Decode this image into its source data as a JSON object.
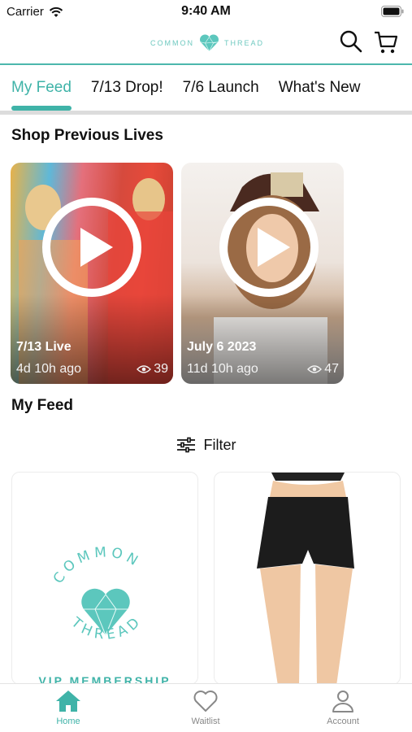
{
  "status_bar": {
    "carrier": "Carrier",
    "time": "9:40 AM"
  },
  "header": {
    "logo_left": "COMMON",
    "logo_right": "THREAD",
    "brand_color": "#3fb3a8"
  },
  "tabs": [
    {
      "label": "My Feed",
      "active": true
    },
    {
      "label": "7/13 Drop!",
      "active": false
    },
    {
      "label": "7/6 Launch",
      "active": false
    },
    {
      "label": "What's New",
      "active": false
    }
  ],
  "previous_lives": {
    "title": "Shop Previous Lives",
    "items": [
      {
        "title": "7/13 Live",
        "ago": "4d 10h ago",
        "views": "39"
      },
      {
        "title": "July 6 2023",
        "ago": "11d 10h ago",
        "views": "47"
      }
    ]
  },
  "feed": {
    "title": "My Feed",
    "filter_label": "Filter",
    "cards": [
      {
        "logo_top": "COMMON",
        "logo_bottom": "THREAD",
        "caption": "VIP MEMBERSHIP"
      },
      {
        "caption": ""
      }
    ]
  },
  "bottom_nav": [
    {
      "label": "Home",
      "icon": "home-icon",
      "active": true
    },
    {
      "label": "Waitlist",
      "icon": "heart-icon",
      "active": false
    },
    {
      "label": "Account",
      "icon": "person-icon",
      "active": false
    }
  ]
}
